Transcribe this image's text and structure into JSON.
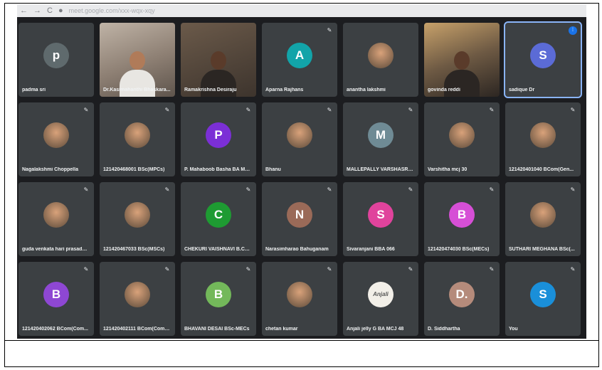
{
  "browser": {
    "url": "meet.google.com/xxx-wqx-xqy"
  },
  "tiles": [
    {
      "name": "padma sri",
      "initial": "p",
      "color": "#5f6a6d",
      "kind": "avatar"
    },
    {
      "name": "Dr.Kasimahanthi Bhaskara...",
      "initial": "",
      "color": "",
      "kind": "video"
    },
    {
      "name": "Ramakrishna Desiraju",
      "initial": "",
      "color": "",
      "kind": "video2"
    },
    {
      "name": "Aparna Rajhans",
      "initial": "A",
      "color": "#12a4a9",
      "kind": "avatar"
    },
    {
      "name": "anantha lakshmi",
      "initial": "",
      "color": "",
      "kind": "photo"
    },
    {
      "name": "govinda reddi",
      "initial": "",
      "color": "",
      "kind": "video3"
    },
    {
      "name": "sadique Dr",
      "initial": "S",
      "color": "#5b6bd6",
      "kind": "avatar",
      "active": true
    },
    {
      "name": "Nagalakshmi Choppella",
      "initial": "",
      "color": "",
      "kind": "photo"
    },
    {
      "name": "121420468001 BSc(MPCs)",
      "initial": "",
      "color": "",
      "kind": "photo"
    },
    {
      "name": "P. Mahaboob Basha BA MC...",
      "initial": "P",
      "color": "#7b2fd6",
      "kind": "avatar"
    },
    {
      "name": "Bhanu",
      "initial": "",
      "color": "",
      "kind": "photo"
    },
    {
      "name": "MALLEPALLY VARSHASRI B...",
      "initial": "M",
      "color": "#6f8b95",
      "kind": "avatar"
    },
    {
      "name": "Varshitha mcj 30",
      "initial": "",
      "color": "",
      "kind": "photo"
    },
    {
      "name": "121420401040 BCom(Gen...",
      "initial": "",
      "color": "",
      "kind": "photo"
    },
    {
      "name": "guda venkata hari prasada ...",
      "initial": "",
      "color": "",
      "kind": "photo"
    },
    {
      "name": "121420467033 BSc(MSCs)",
      "initial": "",
      "color": "",
      "kind": "photo"
    },
    {
      "name": "CHEKURI VAISHNAVI B.Co...",
      "initial": "C",
      "color": "#1e9b32",
      "kind": "avatar"
    },
    {
      "name": "Narasimharao Bahuganam",
      "initial": "N",
      "color": "#9a6a58",
      "kind": "avatar"
    },
    {
      "name": "Sivaranjani BBA 066",
      "initial": "S",
      "color": "#e0439c",
      "kind": "avatar"
    },
    {
      "name": "121420474030 BSc(MECs)",
      "initial": "B",
      "color": "#d64fd6",
      "kind": "avatar"
    },
    {
      "name": "SUTHARI MEGHANA BSc(...",
      "initial": "",
      "color": "",
      "kind": "photo"
    },
    {
      "name": "121420402062 BCom(Com...",
      "initial": "B",
      "color": "#8e47d3",
      "kind": "avatar"
    },
    {
      "name": "121420402111 BCom(Comp...",
      "initial": "",
      "color": "",
      "kind": "photo"
    },
    {
      "name": "BHAVANI DESAI BSc-MECs",
      "initial": "B",
      "color": "#73b85a",
      "kind": "avatar"
    },
    {
      "name": "chetan kumar",
      "initial": "",
      "color": "",
      "kind": "photo"
    },
    {
      "name": "Anjali jelly G BA MCJ 48",
      "initial": "Anjali",
      "color": "#f2efe8",
      "kind": "logo"
    },
    {
      "name": "D. Siddhartha",
      "initial": "D.",
      "color": "#b58b7b",
      "kind": "avatar"
    },
    {
      "name": "You",
      "initial": "S",
      "color": "#1a8fd9",
      "kind": "avatar"
    }
  ]
}
